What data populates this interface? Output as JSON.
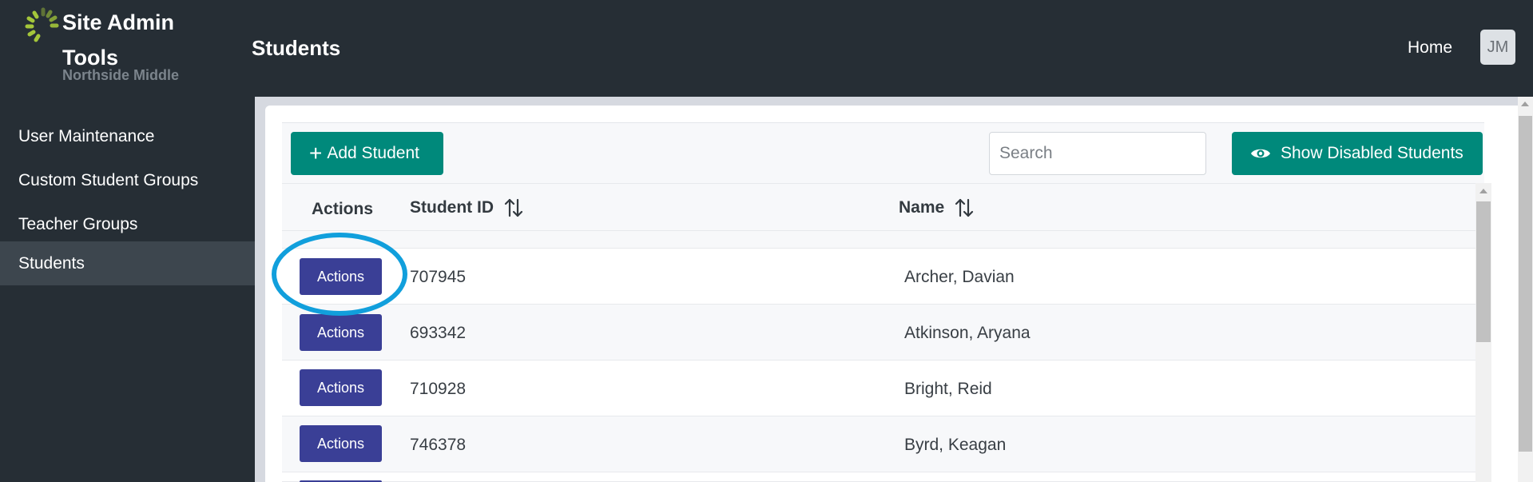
{
  "header": {
    "brand_title": "Site Admin Tools",
    "brand_subtitle": "Northside Middle",
    "page_title": "Students",
    "home_label": "Home",
    "avatar_initials": "JM"
  },
  "sidebar": {
    "items": [
      {
        "label": "User Maintenance"
      },
      {
        "label": "Custom Student Groups"
      },
      {
        "label": "Teacher Groups"
      },
      {
        "label": "Students",
        "active": true
      }
    ]
  },
  "toolbar": {
    "add_label": "Add Student",
    "search_placeholder": "Search",
    "search_value": "",
    "show_disabled_label": "Show Disabled Students"
  },
  "table": {
    "headers": {
      "actions": "Actions",
      "student_id": "Student ID",
      "name": "Name"
    },
    "rows": [
      {
        "action_label": "Actions",
        "student_id": "707945",
        "name": "Archer, Davian"
      },
      {
        "action_label": "Actions",
        "student_id": "693342",
        "name": "Atkinson, Aryana"
      },
      {
        "action_label": "Actions",
        "student_id": "710928",
        "name": "Bright, Reid"
      },
      {
        "action_label": "Actions",
        "student_id": "746378",
        "name": "Byrd, Keagan"
      }
    ]
  },
  "colors": {
    "header_bg": "#262e35",
    "accent_teal": "#00897b",
    "action_button": "#3a3f96",
    "highlight_circle": "#119fdc",
    "logo_green": "#a4c63a"
  },
  "icons": {
    "logo": "spinner-logo-icon",
    "add": "plus-icon",
    "show_disabled": "eye-icon",
    "sort": "sort-arrows-icon"
  }
}
